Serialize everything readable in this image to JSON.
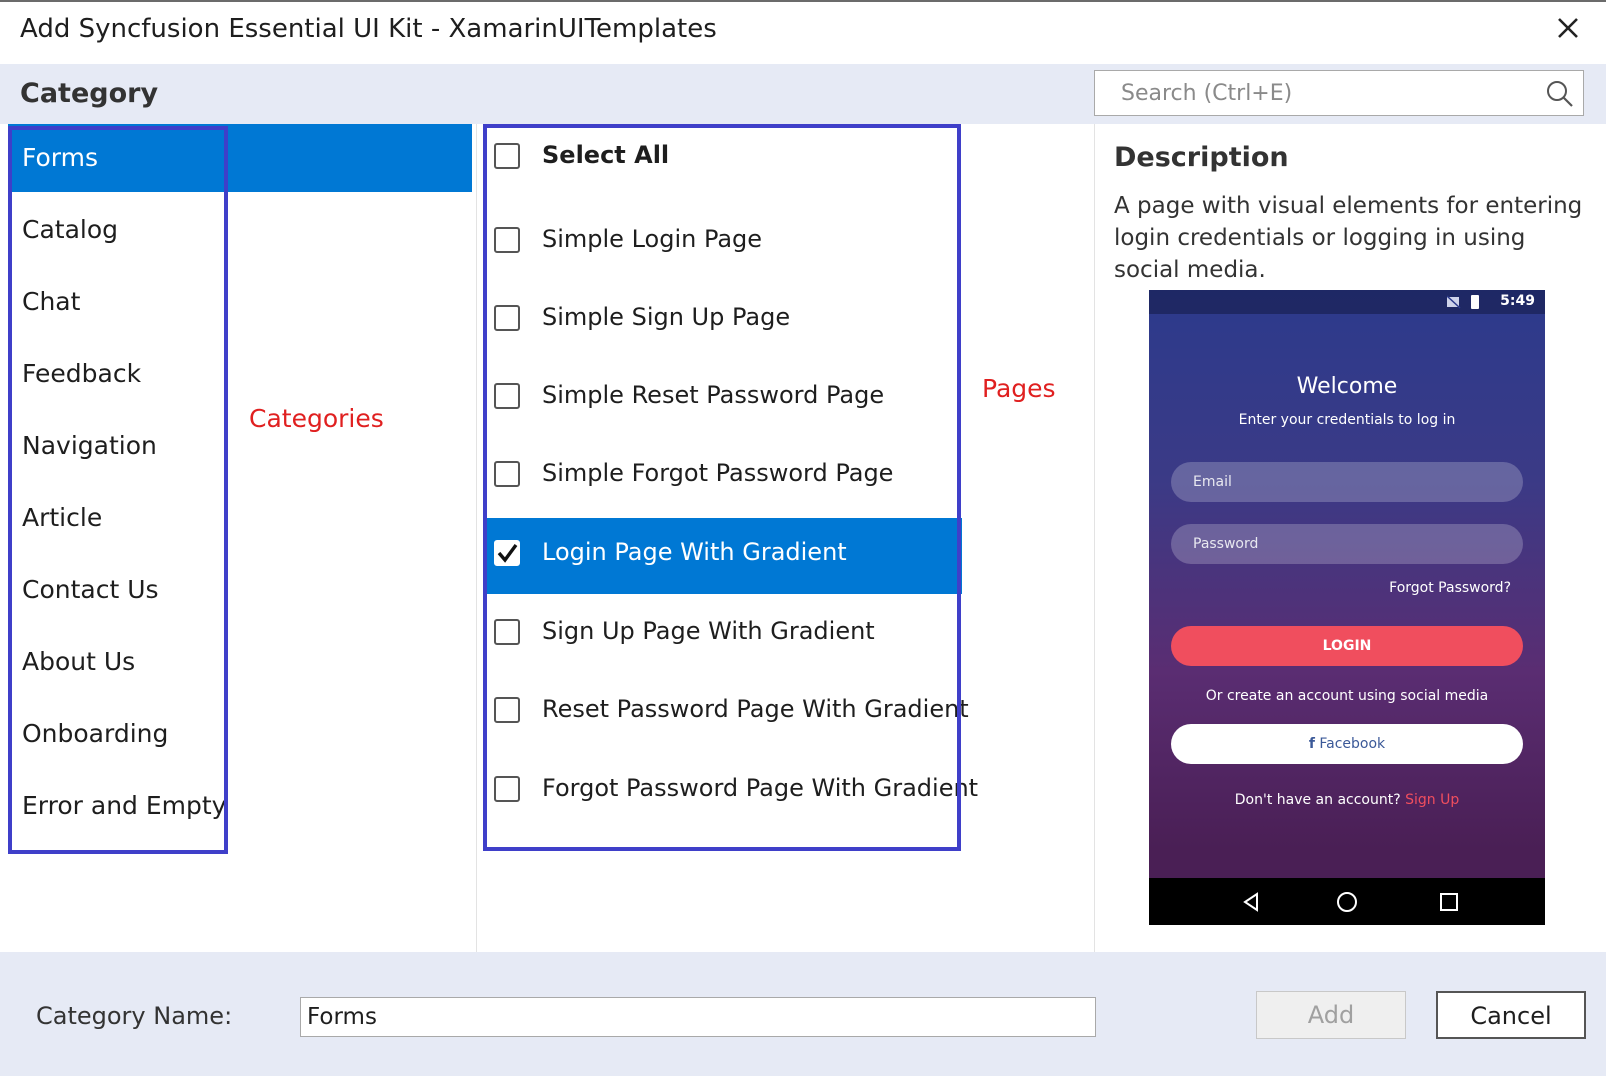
{
  "window": {
    "title": "Add Syncfusion Essential UI Kit - XamarinUITemplates"
  },
  "category_header": "Category",
  "search": {
    "placeholder": "Search (Ctrl+E)"
  },
  "categories": [
    {
      "label": "Forms",
      "selected": true
    },
    {
      "label": "Catalog"
    },
    {
      "label": "Chat"
    },
    {
      "label": "Feedback"
    },
    {
      "label": "Navigation"
    },
    {
      "label": "Article"
    },
    {
      "label": "Contact Us"
    },
    {
      "label": "About Us"
    },
    {
      "label": "Onboarding"
    },
    {
      "label": "Error and Empty"
    }
  ],
  "annotations": {
    "categories": "Categories",
    "pages": "Pages"
  },
  "pages": [
    {
      "label": "Select All",
      "checked": false
    },
    {
      "label": "Simple Login Page",
      "checked": false
    },
    {
      "label": "Simple Sign Up Page",
      "checked": false
    },
    {
      "label": "Simple Reset Password Page",
      "checked": false
    },
    {
      "label": "Simple Forgot Password Page",
      "checked": false
    },
    {
      "label": "Login Page With Gradient",
      "checked": true,
      "selected": true
    },
    {
      "label": "Sign Up Page With Gradient",
      "checked": false
    },
    {
      "label": "Reset Password Page With Gradient",
      "checked": false
    },
    {
      "label": "Forgot Password Page With Gradient",
      "checked": false
    }
  ],
  "description": {
    "heading": "Description",
    "text": "A page with visual elements for entering login credentials or logging in using social media."
  },
  "preview": {
    "time": "5:49",
    "welcome": "Welcome",
    "subtitle": "Enter your credentials to log in",
    "email_placeholder": "Email",
    "password_placeholder": "Password",
    "forgot": "Forgot Password?",
    "login": "LOGIN",
    "or_text": "Or create an account using social media",
    "facebook": "Facebook",
    "no_account": "Don't have an account?",
    "sign_up": "Sign Up"
  },
  "footer": {
    "category_name_label": "Category Name:",
    "category_name_value": "Forms",
    "add_label": "Add",
    "cancel_label": "Cancel"
  },
  "colors": {
    "accent": "#0078d4",
    "annotation_box": "#3f3fc9",
    "annotation_text": "#e02020",
    "login_button": "#f04e5e"
  }
}
